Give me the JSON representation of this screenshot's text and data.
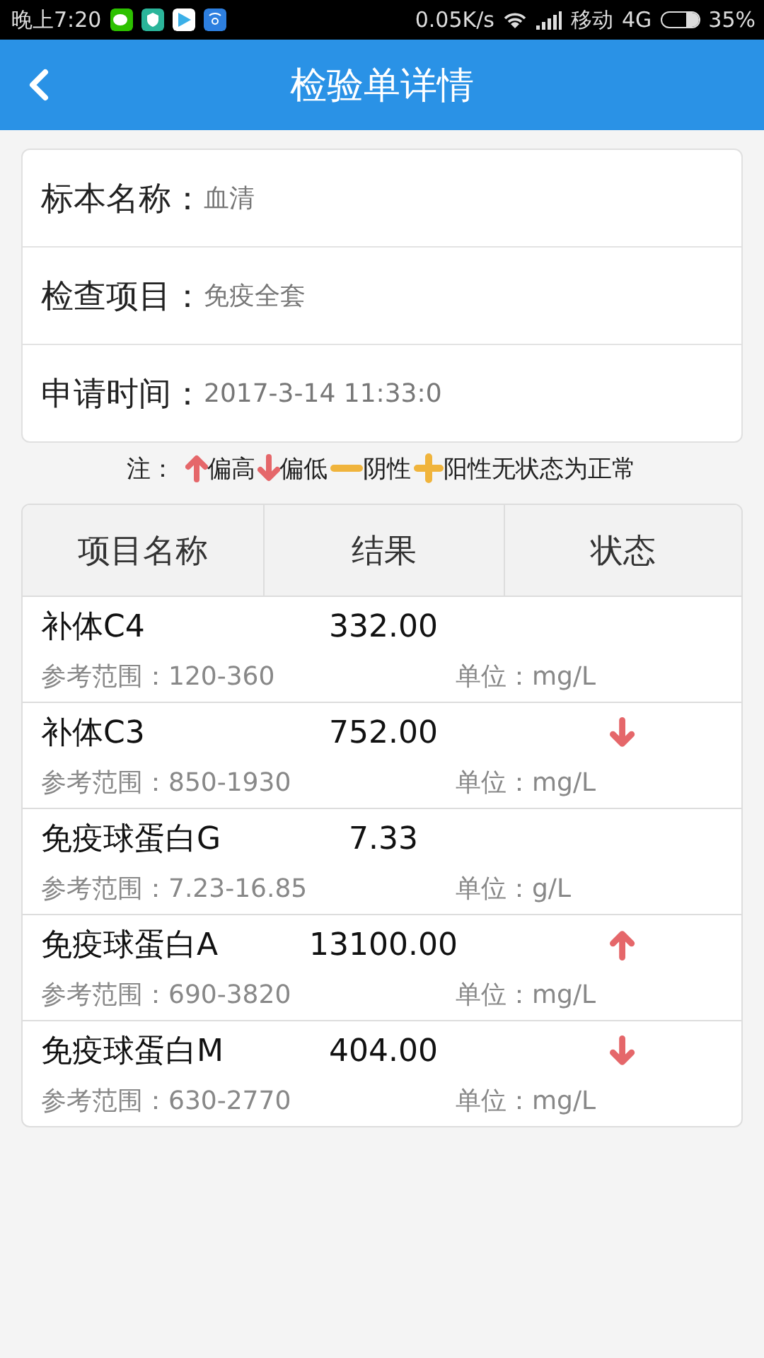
{
  "status_bar": {
    "time": "晚上7:20",
    "speed": "0.05K/s",
    "carrier": "移动",
    "network": "4G",
    "battery": "35%"
  },
  "header": {
    "title": "检验单详情"
  },
  "info": [
    {
      "label": "标本名称：",
      "value": "血清"
    },
    {
      "label": "检查项目：",
      "value": "免疫全套"
    },
    {
      "label": "申请时间：",
      "value": "2017-3-14 11:33:0"
    }
  ],
  "legend": [
    {
      "kind": "text",
      "text": "注："
    },
    {
      "kind": "high",
      "text": "偏高"
    },
    {
      "kind": "low",
      "text": "偏低"
    },
    {
      "kind": "negative",
      "text": "阴性"
    },
    {
      "kind": "positive",
      "text": "阳性无状态为正常"
    }
  ],
  "table": {
    "columns": [
      "项目名称",
      "结果",
      "状态"
    ],
    "rows": [
      {
        "name": "补体C4",
        "result": "332.00",
        "high": false,
        "low": false,
        "range": "参考范围：120-360",
        "unit": "单位：mg/L"
      },
      {
        "name": "补体C3",
        "result": "752.00",
        "high": false,
        "low": true,
        "range": "参考范围：850-1930",
        "unit": "单位：mg/L"
      },
      {
        "name": "免疫球蛋白G",
        "result": "7.33",
        "high": false,
        "low": false,
        "range": "参考范围：7.23-16.85",
        "unit": "单位：g/L"
      },
      {
        "name": "免疫球蛋白A",
        "result": "13100.00",
        "high": true,
        "low": false,
        "range": "参考范围：690-3820",
        "unit": "单位：mg/L"
      },
      {
        "name": "免疫球蛋白M",
        "result": "404.00",
        "high": false,
        "low": true,
        "range": "参考范围：630-2770",
        "unit": "单位：mg/L"
      }
    ]
  }
}
